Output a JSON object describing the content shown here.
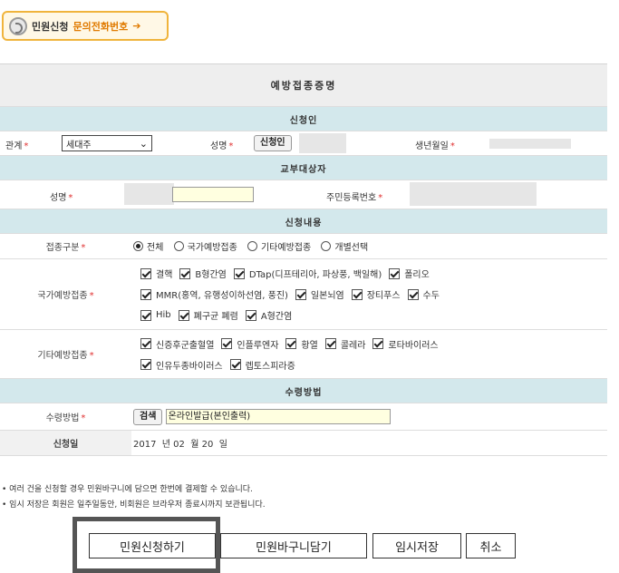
{
  "top_badge": {
    "label_main": "민원신청",
    "label_accent": "문의전화번호",
    "arrow": "➔"
  },
  "form": {
    "title": "예방접종증명",
    "sections": {
      "applicant": "신청인",
      "target": "교부대상자",
      "content": "신청내용",
      "receive": "수령방법"
    },
    "applicant": {
      "relation_label": "관계",
      "relation_value": "세대주",
      "name_label": "성명",
      "self_button": "신청인",
      "birth_label": "생년월일"
    },
    "target": {
      "name_label": "성명",
      "rrn_label": "주민등록번호"
    },
    "content": {
      "type_label": "접종구분",
      "type_options": [
        "전체",
        "국가예방접종",
        "기타예방접종",
        "개별선택"
      ],
      "type_selected": "전체",
      "national_label": "국가예방접종",
      "national_lines": [
        [
          "결핵",
          "B형간염",
          "DTap(디프테리아, 파상풍, 백일해)",
          "폴리오"
        ],
        [
          "MMR(홍역, 유행성이하선염, 풍진)",
          "일본뇌염",
          "장티푸스",
          "수두"
        ],
        [
          "Hib",
          "폐구균 폐렴",
          "A형간염"
        ]
      ],
      "other_label": "기타예방접종",
      "other_lines": [
        [
          "신증후군출혈열",
          "인플루엔자",
          "황열",
          "콜레라",
          "로타바이러스"
        ],
        [
          "인유두종바이러스",
          "렙토스피라증"
        ]
      ]
    },
    "receive": {
      "method_label": "수령방법",
      "search_button": "검색",
      "method_value": "온라인발급(본인출력)",
      "date_label": "신청일",
      "date_value": "2017  년 02  월 20  일"
    }
  },
  "notes": [
    "• 여러 건을 신청할 경우 민원바구니에 담으면 한번에 결제할 수 있습니다.",
    "• 임시 저장은 회원은 일주일동안, 비회원은 브라우저 종료시까지 보관됩니다."
  ],
  "buttons": {
    "apply": "민원신청하기",
    "basket": "민원바구니담기",
    "temp_save": "임시저장",
    "cancel": "취소"
  },
  "required_mark": "*"
}
